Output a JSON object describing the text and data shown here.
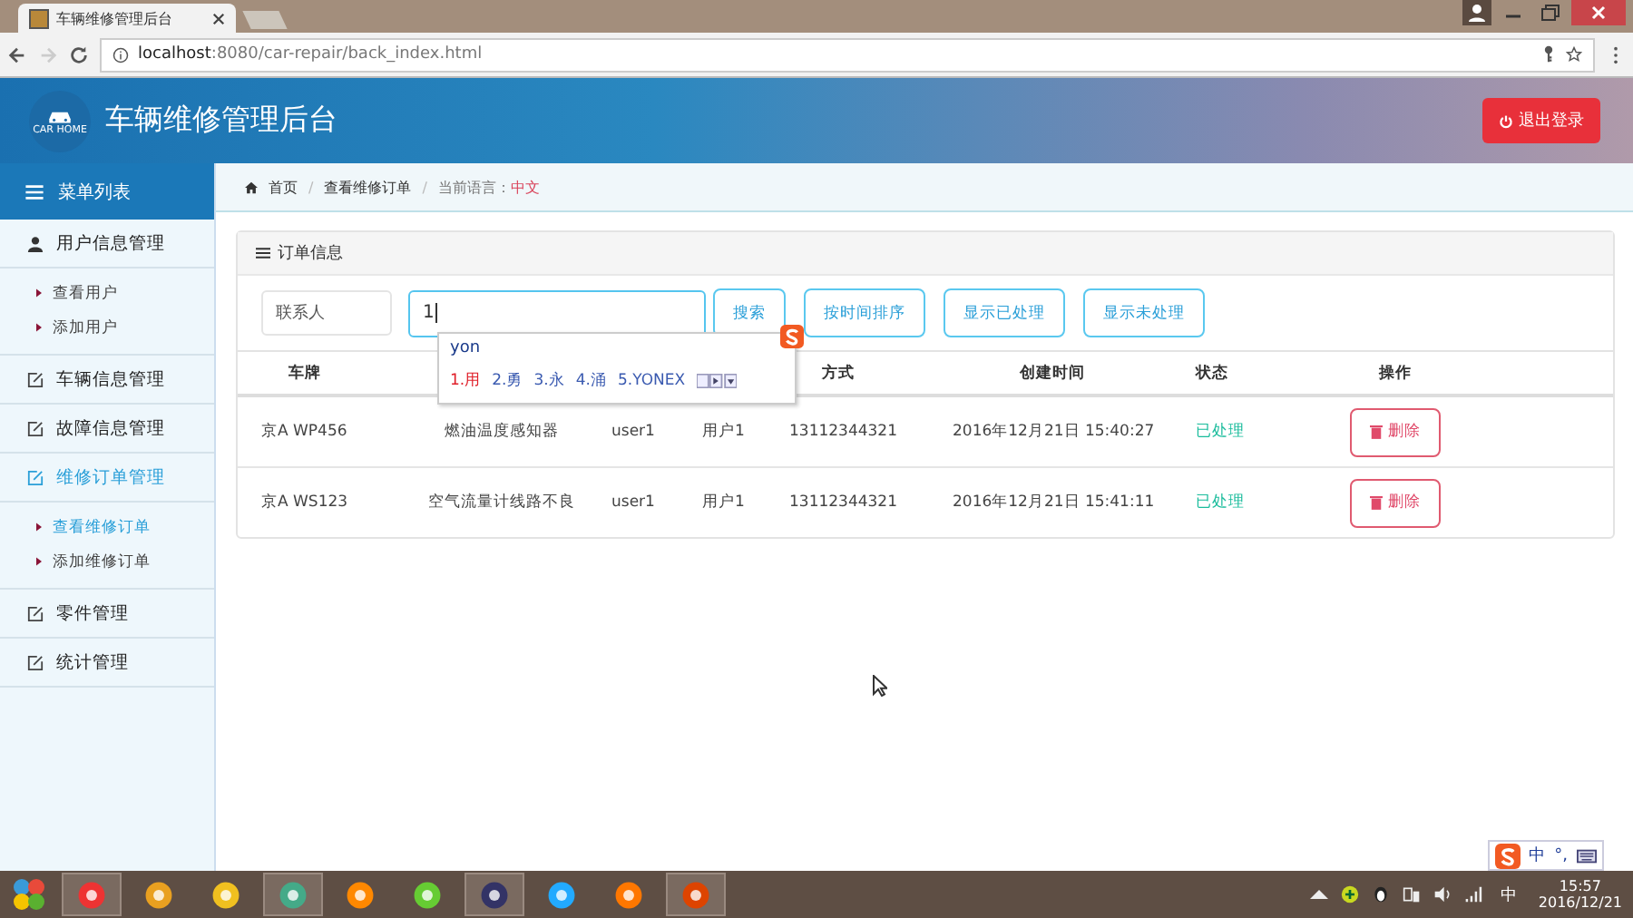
{
  "browser": {
    "tab_title": "车辆维修管理后台",
    "url_host": "localhost",
    "url_rest": ":8080/car-repair/back_index.html"
  },
  "header": {
    "title": "车辆维修管理后台",
    "logo_text": "CAR HOME",
    "logout": "退出登录"
  },
  "sidebar": {
    "heading": "菜单列表",
    "items": [
      {
        "label": "用户信息管理",
        "kind": "user",
        "selected": false,
        "children": [
          {
            "label": "查看用户",
            "selected": false
          },
          {
            "label": "添加用户",
            "selected": false
          }
        ]
      },
      {
        "label": "车辆信息管理",
        "kind": "edit",
        "selected": false
      },
      {
        "label": "故障信息管理",
        "kind": "edit",
        "selected": false
      },
      {
        "label": "维修订单管理",
        "kind": "edit",
        "selected": true,
        "children": [
          {
            "label": "查看维修订单",
            "selected": true
          },
          {
            "label": "添加维修订单",
            "selected": false
          }
        ]
      },
      {
        "label": "零件管理",
        "kind": "edit",
        "selected": false
      },
      {
        "label": "统计管理",
        "kind": "edit",
        "selected": false
      }
    ]
  },
  "breadcrumb": {
    "separator": "/",
    "home": "首页",
    "current": "查看维修订单",
    "language_label": "当前语言：",
    "language": "中文"
  },
  "panel": {
    "title": "订单信息",
    "filter": {
      "field": "联系人",
      "query": "1"
    },
    "buttons": [
      "搜索",
      "按时间排序",
      "显示已处理",
      "显示未处理"
    ],
    "ime": {
      "typed": "yon",
      "candidates": [
        "1.用",
        "2.勇",
        "3.永",
        "4.涌",
        "5.YONEX"
      ]
    },
    "columns": [
      {
        "label": "车牌"
      },
      {},
      {},
      {},
      {
        "label": "方式"
      },
      {
        "label": "创建时间"
      },
      {
        "label": "状态"
      },
      {
        "label": "操作"
      }
    ],
    "rows": [
      {
        "cells": [
          "京A WP456",
          "燃油温度感知器",
          "user1",
          "用户1",
          "13112344321",
          "2016年12月21日 15:40:27"
        ],
        "status": "已处理",
        "action": "删除"
      },
      {
        "cells": [
          "京A WS123",
          "空气流量计线路不良",
          "user1",
          "用户1",
          "13112344321",
          "2016年12月21日 15:41:11"
        ],
        "status": "已处理",
        "action": "删除"
      }
    ]
  },
  "ime_bar": {
    "mode": "中",
    "punct": "°,"
  },
  "taskbar": {
    "apps": [
      {
        "open": true
      },
      {
        "open": false
      },
      {
        "open": false
      },
      {
        "open": true
      },
      {
        "open": false
      },
      {
        "open": false
      },
      {
        "open": true
      },
      {
        "open": false
      },
      {
        "open": false
      },
      {
        "open": true
      }
    ],
    "tray_lang": "中",
    "time": "15:57",
    "date": "2016/12/21"
  }
}
